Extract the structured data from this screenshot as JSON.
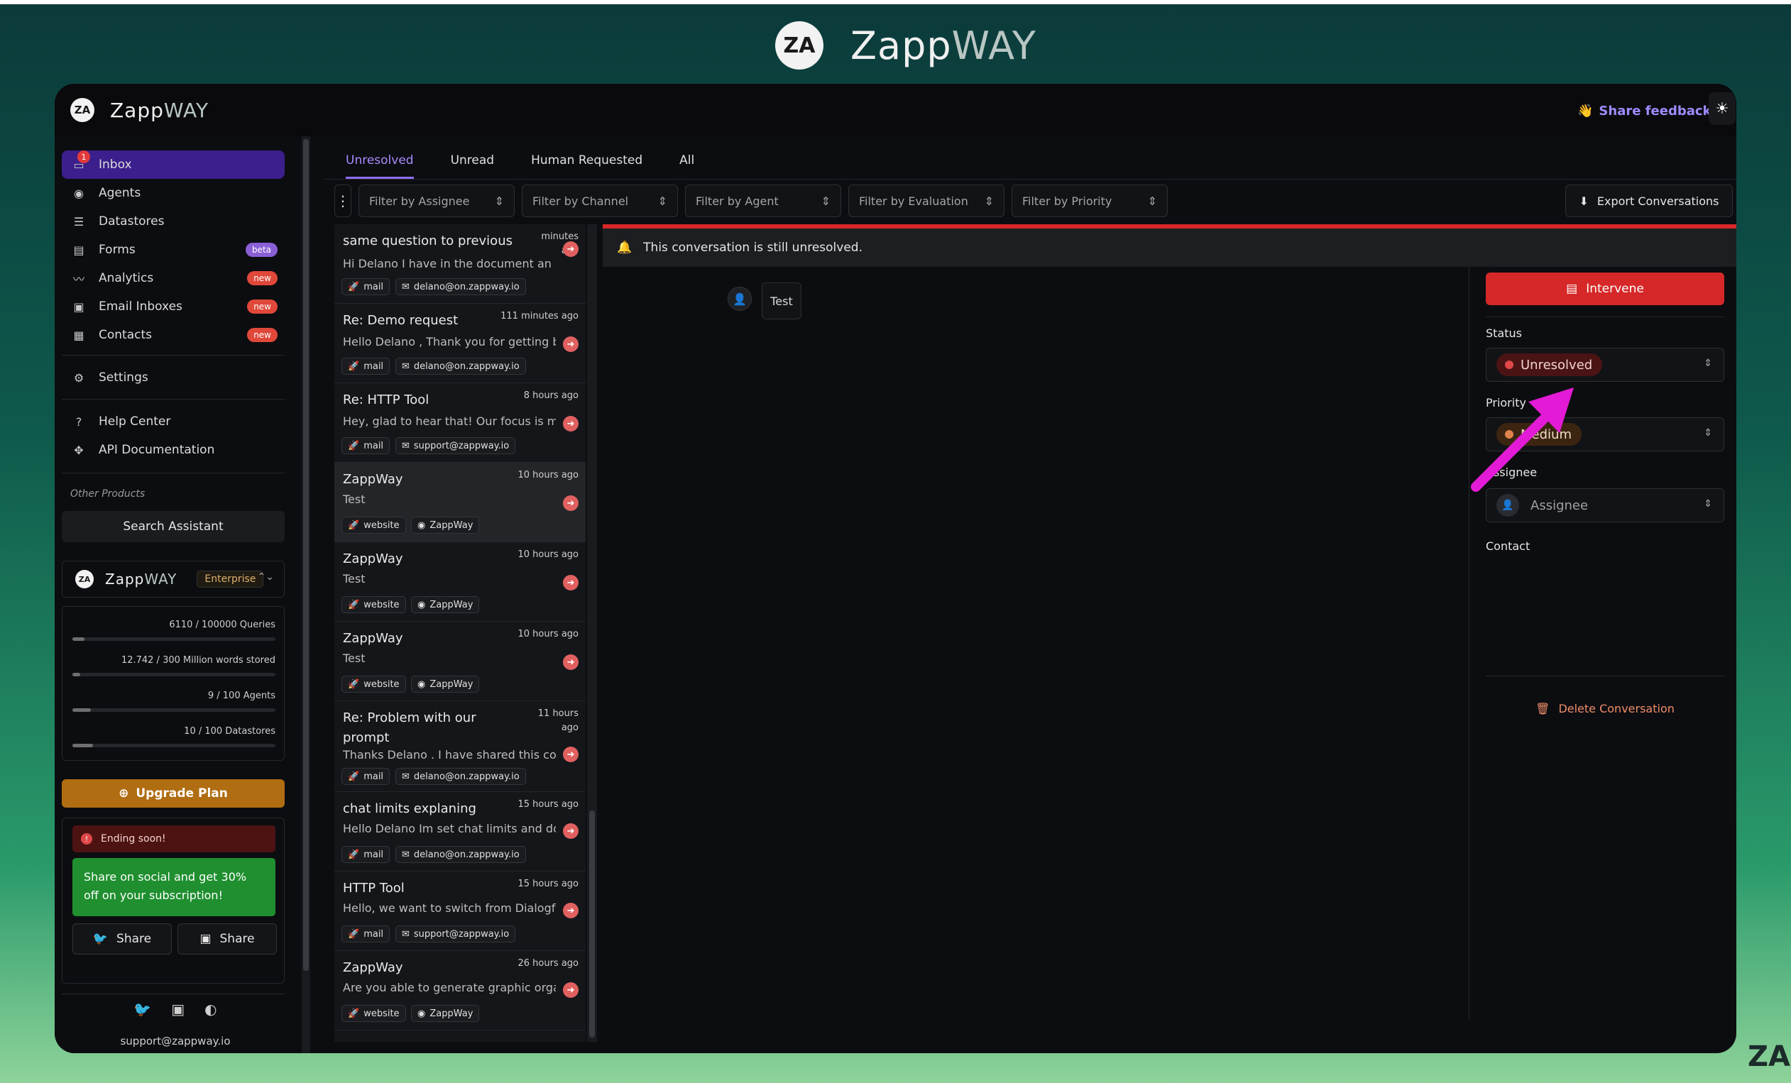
{
  "brand": {
    "name_a": "Zapp",
    "name_b": "WAY",
    "logo_mark": "ZA"
  },
  "header": {
    "share_feedback": "Share feedback",
    "share_feedback_icon": "👋",
    "theme_icon": "☀"
  },
  "sidebar": {
    "inbox_badge": "1",
    "items": [
      {
        "label": "Inbox",
        "icon": "inbox-icon"
      },
      {
        "label": "Agents",
        "icon": "robot-icon"
      },
      {
        "label": "Datastores",
        "icon": "database-icon"
      },
      {
        "label": "Forms",
        "icon": "form-icon",
        "badge": "beta"
      },
      {
        "label": "Analytics",
        "icon": "chart-icon",
        "badge": "new"
      },
      {
        "label": "Email Inboxes",
        "icon": "email-icon",
        "badge": "new"
      },
      {
        "label": "Contacts",
        "icon": "contacts-icon",
        "badge": "new"
      },
      {
        "label": "Settings",
        "icon": "settings-icon"
      },
      {
        "label": "Help Center",
        "icon": "help-icon"
      },
      {
        "label": "API Documentation",
        "icon": "api-icon"
      }
    ],
    "other_products": "Other Products",
    "search_assistant": "Search Assistant",
    "plan": {
      "tier": "Enterprise"
    },
    "usage": [
      {
        "label": "6110 / 100000 Queries",
        "fraction": 0.061
      },
      {
        "label": "12.742 / 300 Million words stored",
        "fraction": 0.04
      },
      {
        "label": "9 / 100 Agents",
        "fraction": 0.09
      },
      {
        "label": "10 / 100 Datastores",
        "fraction": 0.1
      }
    ],
    "upgrade": "Upgrade Plan",
    "ending_soon": "Ending soon!",
    "promo_text": "Share on social and get 30% off on your subscription!",
    "share_twitter": "Share",
    "share_linkedin": "Share",
    "support_email": "support@zappway.io"
  },
  "tabs": [
    {
      "label": "Unresolved",
      "active": true
    },
    {
      "label": "Unread"
    },
    {
      "label": "Human Requested"
    },
    {
      "label": "All"
    }
  ],
  "filters": [
    "Filter by Assignee",
    "Filter by Channel",
    "Filter by Agent",
    "Filter by Evaluation",
    "Filter by Priority"
  ],
  "export": "Export Conversations",
  "conversations": [
    {
      "title": "same question to previous",
      "time": "minutes ago",
      "preview": "Hi  Delano  I have in the document an ex...",
      "channel": "mail",
      "source": "delano@on.zappway.io"
    },
    {
      "title": "Re: Demo request",
      "time": "111 minutes ago",
      "preview": "Hello  Delano , Thank you for getting back",
      "channel": "mail",
      "source": "delano@on.zappway.io"
    },
    {
      "title": "Re: HTTP Tool",
      "time": "8 hours ago",
      "preview": "Hey, glad to hear that! Our focus is mak",
      "channel": "mail",
      "source": "support@zappway.io"
    },
    {
      "title": "ZappWay",
      "time": "10 hours ago",
      "preview": "Test",
      "channel": "website",
      "source": "ZappWay",
      "selected": true
    },
    {
      "title": "ZappWay",
      "time": "10 hours ago",
      "preview": "Test",
      "channel": "website",
      "source": "ZappWay"
    },
    {
      "title": "ZappWay",
      "time": "10 hours ago",
      "preview": "Test",
      "channel": "website",
      "source": "ZappWay"
    },
    {
      "title": "Re: Problem with our prompt",
      "time": "11 hours ago",
      "preview": "Thanks  Delano . I have shared this code",
      "channel": "mail",
      "source": "delano@on.zappway.io"
    },
    {
      "title": "chat limits explaning",
      "time": "15 hours ago",
      "preview": "Hello  Delano  Im set chat limits and do",
      "channel": "mail",
      "source": "delano@on.zappway.io"
    },
    {
      "title": "HTTP Tool",
      "time": "15 hours ago",
      "preview": "Hello, we want to switch from Dialogflow",
      "channel": "mail",
      "source": "support@zappway.io"
    },
    {
      "title": "ZappWay",
      "time": "26 hours ago",
      "preview": "Are you able to generate graphic organ",
      "channel": "website",
      "source": "ZappWay"
    }
  ],
  "conversation": {
    "banner": "This conversation is still unresolved.",
    "message": "Test"
  },
  "details": {
    "intervene": "Intervene",
    "status_label": "Status",
    "status_value": "Unresolved",
    "priority_label": "Priority",
    "priority_value": "Medium",
    "assignee_label": "Assignee",
    "assignee_placeholder": "Assignee",
    "contact_label": "Contact",
    "delete": "Delete Conversation"
  },
  "colors": {
    "accent": "#8f6cf0",
    "danger": "#d62828",
    "annotation": "#e31ad6"
  }
}
